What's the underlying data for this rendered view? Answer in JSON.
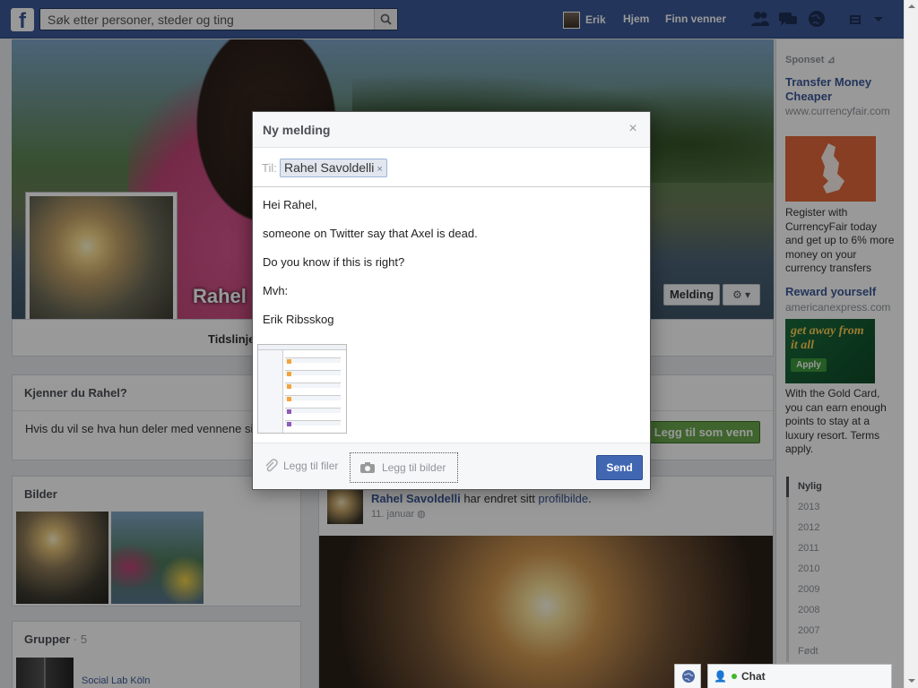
{
  "topbar": {
    "logo": "f",
    "search_placeholder": "Søk etter personer, steder og ting",
    "user_name": "Erik",
    "nav_home": "Hjem",
    "nav_find_friends": "Finn venner",
    "icons": [
      "friend-requests-icon",
      "messages-icon",
      "notifications-icon",
      "privacy-icon",
      "settings-dropdown-icon"
    ]
  },
  "profile": {
    "name": "Rahel",
    "tab_timeline": "Tidslinje",
    "message_button": "Melding",
    "gear_label": "⚙ ▾"
  },
  "know_card": {
    "title": "Kjenner du Rahel?",
    "text": "Hvis du vil se hva hun deler med vennene sine,",
    "add_friend": "Legg til som venn"
  },
  "photos_card": {
    "title": "Bilder"
  },
  "groups_card": {
    "title": "Grupper",
    "count": " · 5",
    "group_name": "Social Lab Köln"
  },
  "feed": {
    "author": "Rahel Savoldelli",
    "action": " har endret sitt ",
    "link": "profilbilde",
    "end": ".",
    "date": "11. januar"
  },
  "sidebar": {
    "sponsored": "Sponset",
    "ads": [
      {
        "title": "Transfer Money Cheaper",
        "url": "www.currencyfair.com",
        "body": "Register with CurrencyFair today and get up to 6% more money on your currency transfers"
      },
      {
        "title": "Reward yourself",
        "url": "americanexpress.com",
        "img_text": "get away from it all",
        "img_btn": "Apply",
        "body": "With the Gold Card, you can earn enough points to stay at a luxury resort. Terms apply."
      }
    ],
    "years": [
      "Nylig",
      "2013",
      "2012",
      "2011",
      "2010",
      "2009",
      "2008",
      "2007",
      "Født"
    ]
  },
  "dialog": {
    "title": "Ny melding",
    "close": "×",
    "to_label": "Til:",
    "recipient": "Rahel Savoldelli",
    "remove": "×",
    "lines": [
      "Hei Rahel,",
      "someone on Twitter say that Axel is dead.",
      "Do you know if this is right?",
      "Mvh:",
      "Erik Ribsskog"
    ],
    "add_files": "Legg til filer",
    "add_photos": "Legg til bilder",
    "send": "Send"
  },
  "chat": {
    "label": "Chat"
  }
}
